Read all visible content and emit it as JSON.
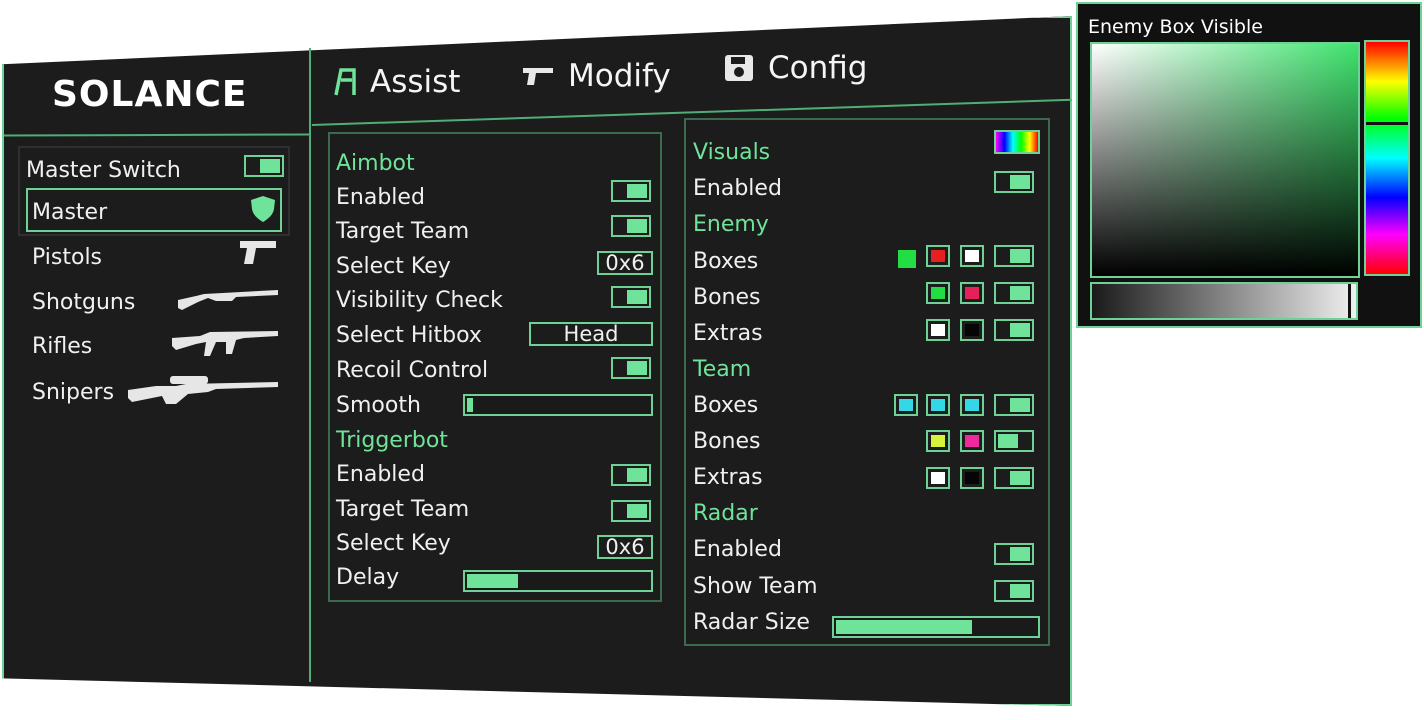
{
  "app": {
    "name": "SOLANCE"
  },
  "tabs": [
    {
      "label": "Assist",
      "icon": "aim-icon"
    },
    {
      "label": "Modify",
      "icon": "pistol-icon"
    },
    {
      "label": "Config",
      "icon": "save-icon"
    }
  ],
  "sidebar": {
    "master_switch": {
      "label": "Master Switch",
      "on": true
    },
    "items": [
      {
        "label": "Master",
        "icon": "shield-icon",
        "selected": true
      },
      {
        "label": "Pistols",
        "icon": "pistol-icon"
      },
      {
        "label": "Shotguns",
        "icon": "shotgun-icon"
      },
      {
        "label": "Rifles",
        "icon": "rifle-icon"
      },
      {
        "label": "Snipers",
        "icon": "sniper-icon"
      }
    ]
  },
  "assist": {
    "aimbot_title": "Aimbot",
    "enabled": "Enabled",
    "target_team": "Target Team",
    "select_key": "Select Key",
    "select_key_value": "0x6",
    "visibility_check": "Visibility Check",
    "select_hitbox": "Select Hitbox",
    "hitbox_value": "Head",
    "recoil_control": "Recoil Control",
    "smooth": "Smooth",
    "smooth_value": 0.02,
    "triggerbot_title": "Triggerbot",
    "tb_enabled": "Enabled",
    "tb_target_team": "Target Team",
    "tb_select_key": "Select Key",
    "tb_select_key_value": "0x6",
    "delay": "Delay",
    "delay_value": 0.28
  },
  "visuals": {
    "title": "Visuals",
    "enabled": "Enabled",
    "enemy_title": "Enemy",
    "enemy_boxes": "Boxes",
    "enemy_bones": "Bones",
    "enemy_extras": "Extras",
    "team_title": "Team",
    "team_boxes": "Boxes",
    "team_bones": "Bones",
    "team_extras": "Extras",
    "radar_title": "Radar",
    "radar_enabled": "Enabled",
    "show_team": "Show Team",
    "radar_size": "Radar Size",
    "radar_size_value": 0.68,
    "colors": {
      "enemy_boxes": [
        "#22dd44",
        "#e62020",
        "#ffffff"
      ],
      "enemy_bones": [
        "#22dd44",
        "#e8205a"
      ],
      "enemy_extras": [
        "#ffffff",
        "#050505"
      ],
      "team_boxes": [
        "#35d6e6",
        "#35d6e6",
        "#35d6e6"
      ],
      "team_bones": [
        "#d6f23a",
        "#ee2a9e"
      ],
      "team_extras": [
        "#ffffff",
        "#050505"
      ]
    }
  },
  "color_picker": {
    "title": "Enemy Box Visible",
    "hue": "#3ee36d",
    "alpha": 0.98
  },
  "accent": "#6fe39a"
}
